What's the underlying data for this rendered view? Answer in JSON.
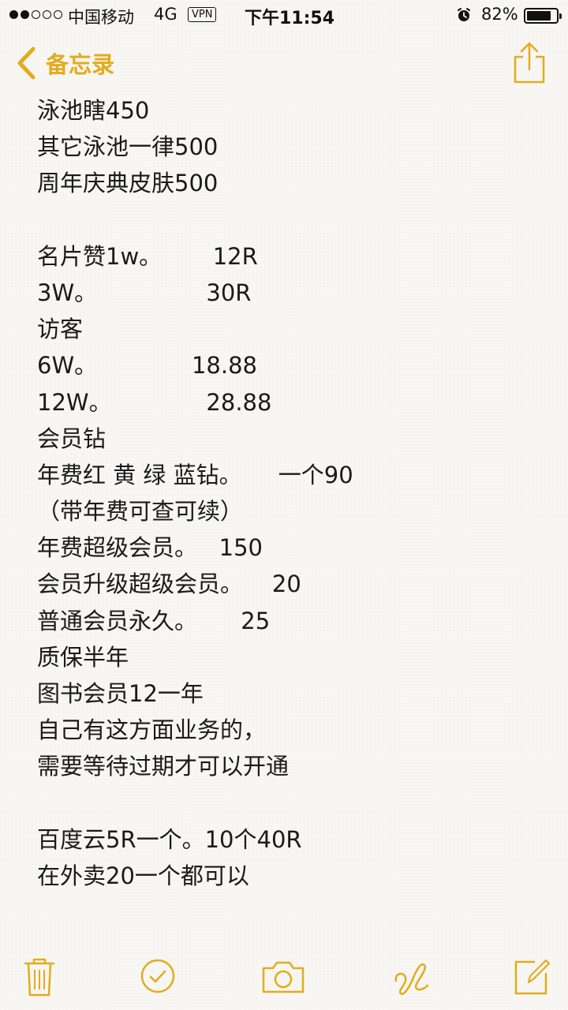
{
  "status_bar": {
    "carrier": "中国移动",
    "network": "4G",
    "vpn_label": "VPN",
    "time": "下午11:54",
    "battery_percent": "82%",
    "battery_level": 0.82,
    "signal_bars_filled": 2,
    "signal_bars_total": 5,
    "alarm_icon": "alarm-clock-icon"
  },
  "nav": {
    "back_label": "备忘录",
    "back_icon": "chevron-left-icon",
    "share_icon": "share-icon",
    "accent_color": "#e2ac1c"
  },
  "note": {
    "lines": [
      "泳池瞎450",
      "其它泳池一律500",
      "周年庆典皮肤500",
      "",
      "名片赞1w。       12R",
      "3W。               30R",
      "访客",
      "6W。             18.88",
      "12W。             28.88",
      "会员钻",
      "年费红 黄 绿 蓝钻。     一个90",
      "（带年费可查可续）",
      "年费超级会员。   150",
      "会员升级超级会员。    20",
      "普通会员永久。      25",
      "质保半年",
      "图书会员12一年",
      "自己有这方面业务的，",
      "需要等待过期才可以开通",
      "",
      "百度云5R一个。10个40R",
      "在外卖20一个都可以"
    ]
  },
  "toolbar": {
    "icons": [
      "trash-icon",
      "checkmark-circle-icon",
      "camera-icon",
      "sketch-icon",
      "compose-icon"
    ]
  }
}
